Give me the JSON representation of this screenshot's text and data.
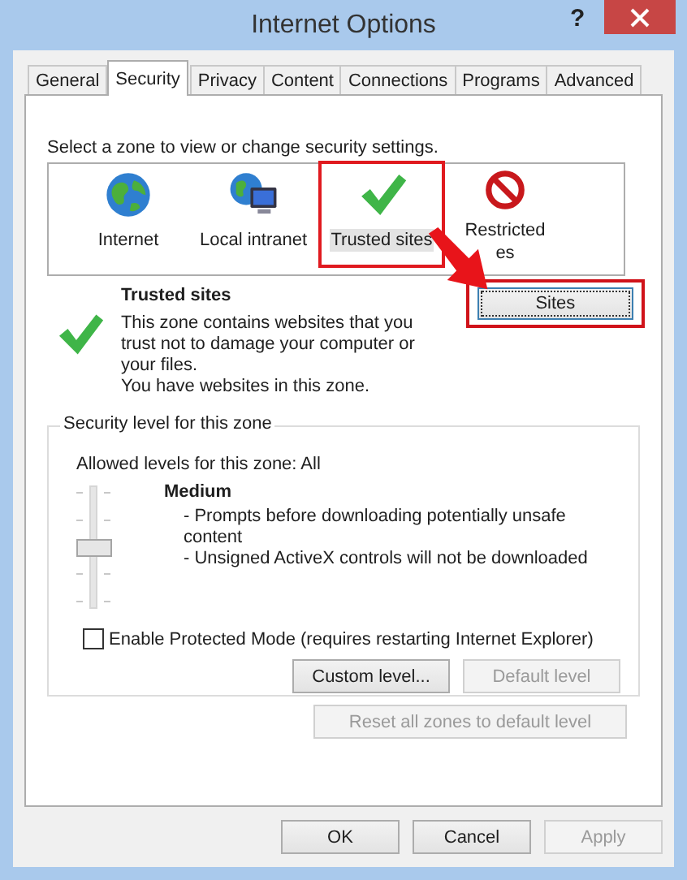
{
  "window": {
    "title": "Internet Options",
    "help": "?"
  },
  "tabs": [
    {
      "label": "General",
      "selected": false
    },
    {
      "label": "Security",
      "selected": true
    },
    {
      "label": "Privacy",
      "selected": false
    },
    {
      "label": "Content",
      "selected": false
    },
    {
      "label": "Connections",
      "selected": false
    },
    {
      "label": "Programs",
      "selected": false
    },
    {
      "label": "Advanced",
      "selected": false
    }
  ],
  "prompt": "Select a zone to view or change security settings.",
  "zones": [
    {
      "kind": "internet",
      "label": "Internet",
      "selected": false,
      "highlighted": false
    },
    {
      "kind": "intranet",
      "label": "Local intranet",
      "selected": false,
      "highlighted": false
    },
    {
      "kind": "trusted",
      "label": "Trusted sites",
      "selected": true,
      "highlighted": true
    },
    {
      "kind": "restricted",
      "label": "Restricted\nes",
      "selected": false,
      "highlighted": false
    }
  ],
  "zone_info": {
    "title": "Trusted sites",
    "description": "This zone contains websites that you trust not to damage your computer or your files.",
    "note": "You have websites in this zone.",
    "sites_button": {
      "label": "Sites",
      "highlighted": true
    }
  },
  "security_level": {
    "legend": "Security level for this zone",
    "allowed": "Allowed levels for this zone: All",
    "level": 0.5,
    "level_name": "Medium",
    "bullets": [
      "- Prompts before downloading potentially unsafe content",
      "- Unsigned ActiveX controls will not be downloaded"
    ],
    "protected_mode": {
      "label": "Enable Protected Mode (requires restarting Internet Explorer)",
      "checked": false
    },
    "buttons": [
      {
        "label": "Custom level...",
        "disabled": false
      },
      {
        "label": "Default level",
        "disabled": true
      }
    ]
  },
  "reset_button": {
    "label": "Reset all zones to default level",
    "disabled": true
  },
  "footer_buttons": [
    {
      "label": "OK",
      "disabled": false
    },
    {
      "label": "Cancel",
      "disabled": false
    },
    {
      "label": "Apply",
      "disabled": true
    }
  ]
}
